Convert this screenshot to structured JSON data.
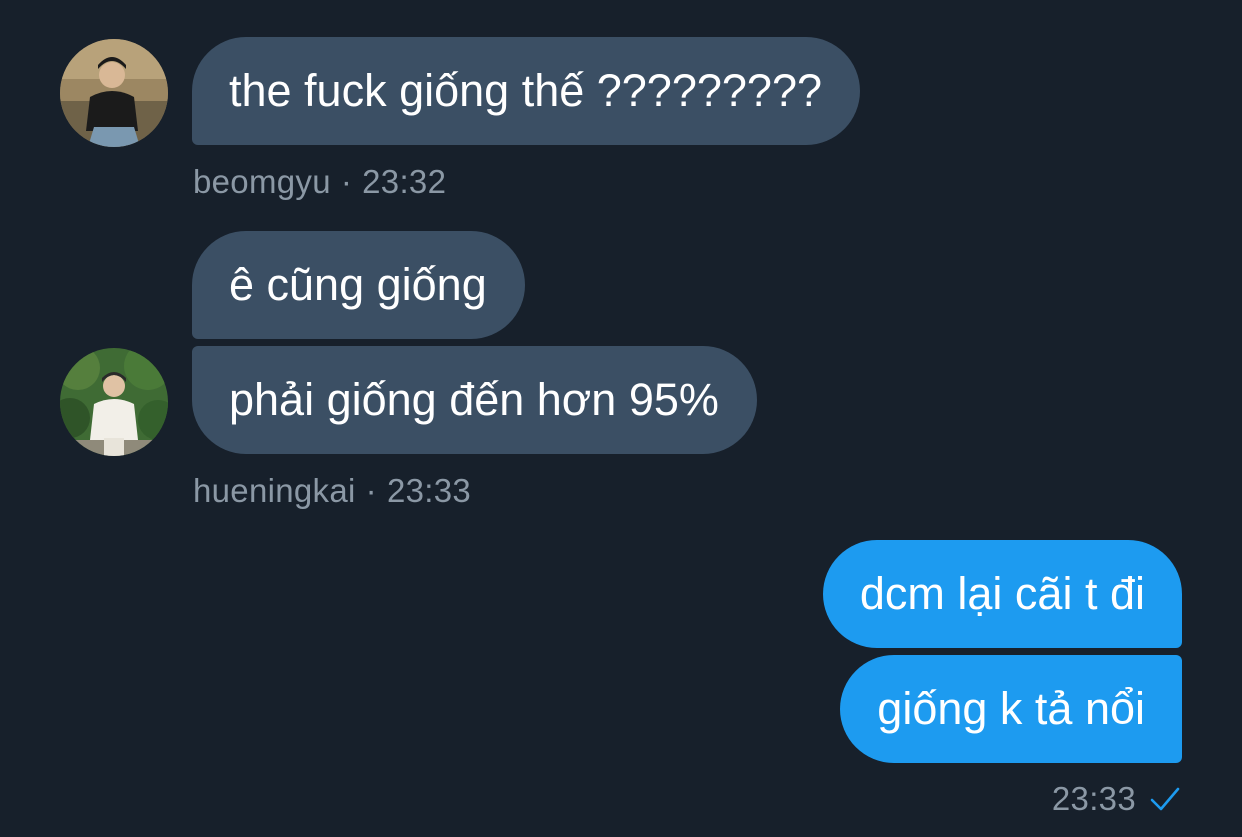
{
  "conversation": {
    "groups": [
      {
        "sender": "beomgyu",
        "time": "23:32",
        "messages": [
          "the fuck giống thế ?????????"
        ]
      },
      {
        "sender": "hueningkai",
        "time": "23:33",
        "messages": [
          "ê cũng giống",
          "phải giống đến hơn 95%"
        ]
      }
    ],
    "outgoing": {
      "messages": [
        "dcm lại cãi t đi",
        "giống k tả nổi"
      ],
      "time": "23:33",
      "status_icon": "checkmark-icon"
    },
    "separator": "·"
  },
  "colors": {
    "background": "#17202b",
    "incoming_bubble": "#3b4f64",
    "outgoing_bubble": "#1d9bf0",
    "meta_text": "#8b98a5"
  }
}
